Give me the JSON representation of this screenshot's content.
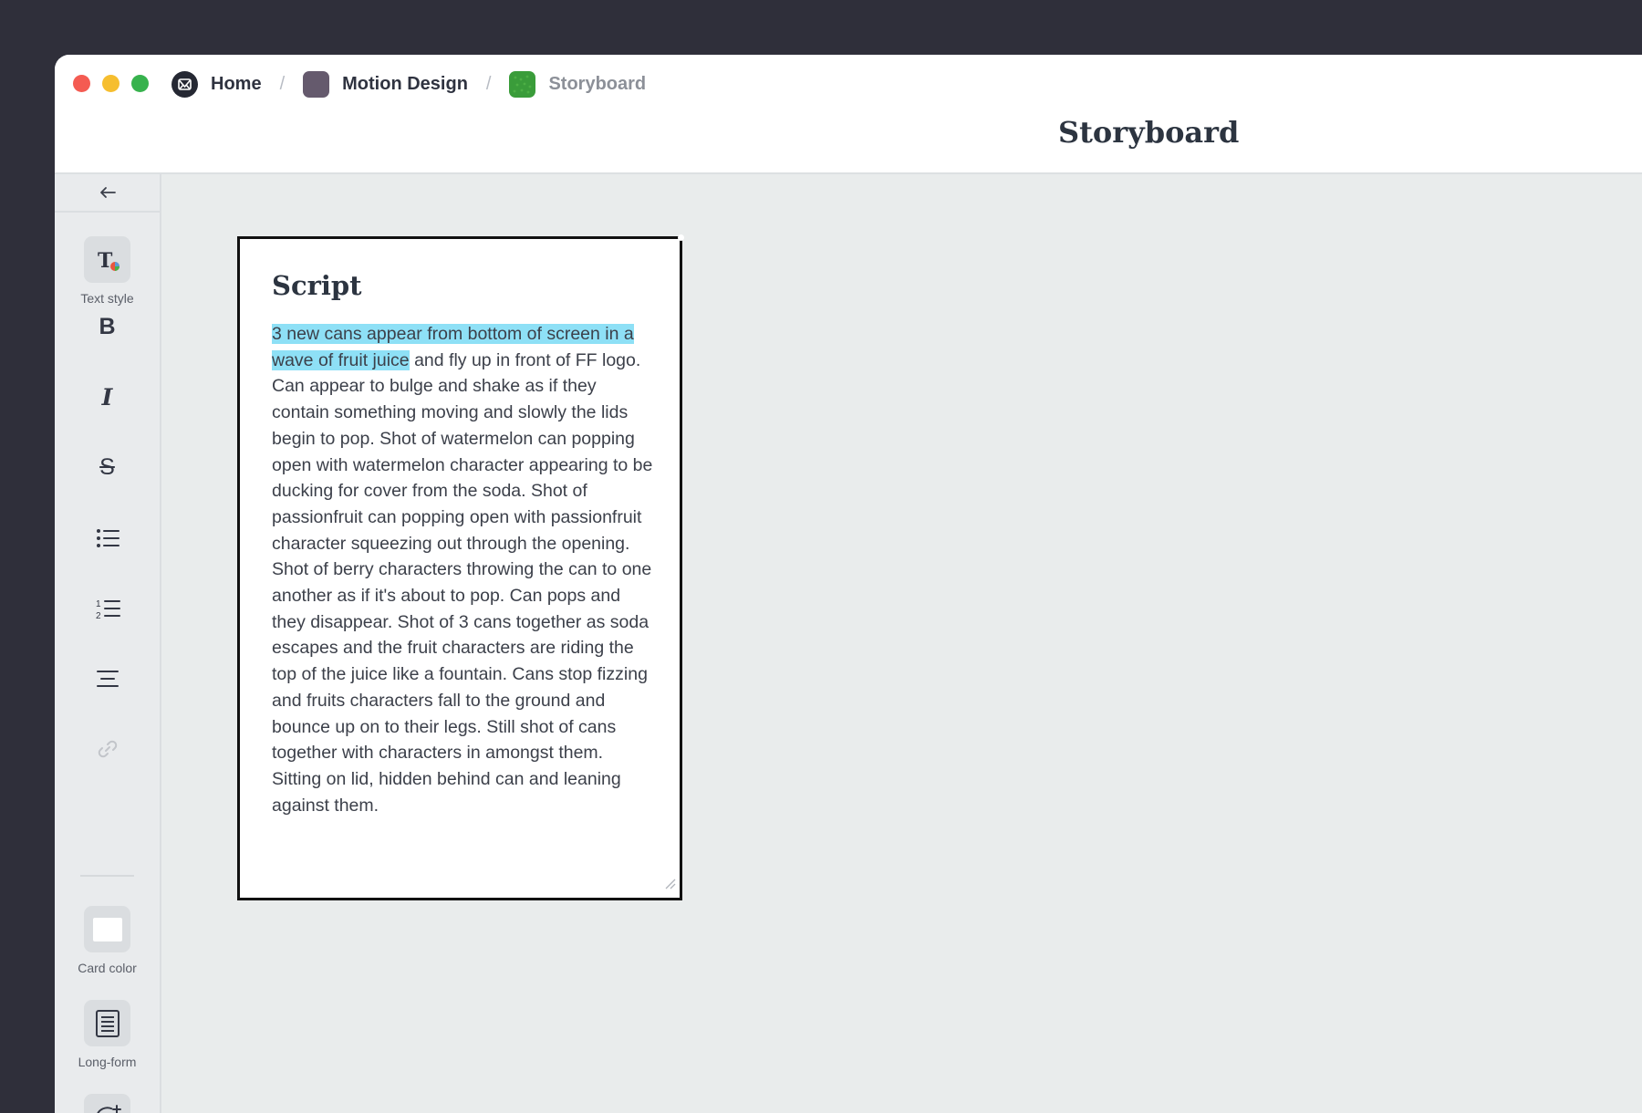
{
  "breadcrumb": {
    "items": [
      {
        "label": "Home",
        "icon": "home-logo-icon"
      },
      {
        "label": "Motion Design",
        "icon": "board-color-icon",
        "color": "#655a6d"
      },
      {
        "label": "Storyboard",
        "icon": "board-color-icon",
        "color": "#3a9c3a"
      }
    ],
    "separator": "/"
  },
  "header": {
    "title": "Storyboard"
  },
  "sidebar": {
    "collapse_icon": "arrow-left-icon",
    "tools": [
      {
        "name": "text-style",
        "label": "Text style",
        "icon": "text-style-icon"
      },
      {
        "name": "bold",
        "label": "B",
        "icon": "bold-icon"
      },
      {
        "name": "italic",
        "label": "I",
        "icon": "italic-icon"
      },
      {
        "name": "strikethrough",
        "label": "S",
        "icon": "strikethrough-icon"
      },
      {
        "name": "bulleted-list",
        "icon": "bulleted-list-icon"
      },
      {
        "name": "numbered-list",
        "icon": "numbered-list-icon"
      },
      {
        "name": "align",
        "icon": "align-center-icon"
      },
      {
        "name": "link",
        "icon": "link-icon",
        "disabled": true
      },
      {
        "name": "card-color",
        "label": "Card color",
        "icon": "card-color-swatch-icon"
      },
      {
        "name": "long-form",
        "label": "Long-form",
        "icon": "long-form-icon"
      },
      {
        "name": "add-reaction",
        "icon": "add-emoji-icon"
      }
    ]
  },
  "card": {
    "title": "Script",
    "highlighted_text": "3 new cans appear from bottom of screen in a wave of fruit juice",
    "body_text": " and fly up in front of FF logo. Can appear to bulge and shake as if they contain something moving and slowly the lids begin to pop. Shot of watermelon can popping open with watermelon character appearing to be ducking for cover from the soda. Shot of passionfruit can popping open with passionfruit character squeezing out through the opening. Shot of berry characters throwing the can to one another as if it's about to pop. Can pops and they disappear. Shot of 3 cans together as soda escapes and the fruit characters are riding the top of the juice like a fountain. Cans stop fizzing and fruits characters fall to the ground and bounce up on to their legs. Still shot of cans together with characters in amongst them. Sitting on lid, hidden behind can and leaning against them.",
    "highlight_color": "#8ee0f6",
    "border_color": "#111111"
  }
}
